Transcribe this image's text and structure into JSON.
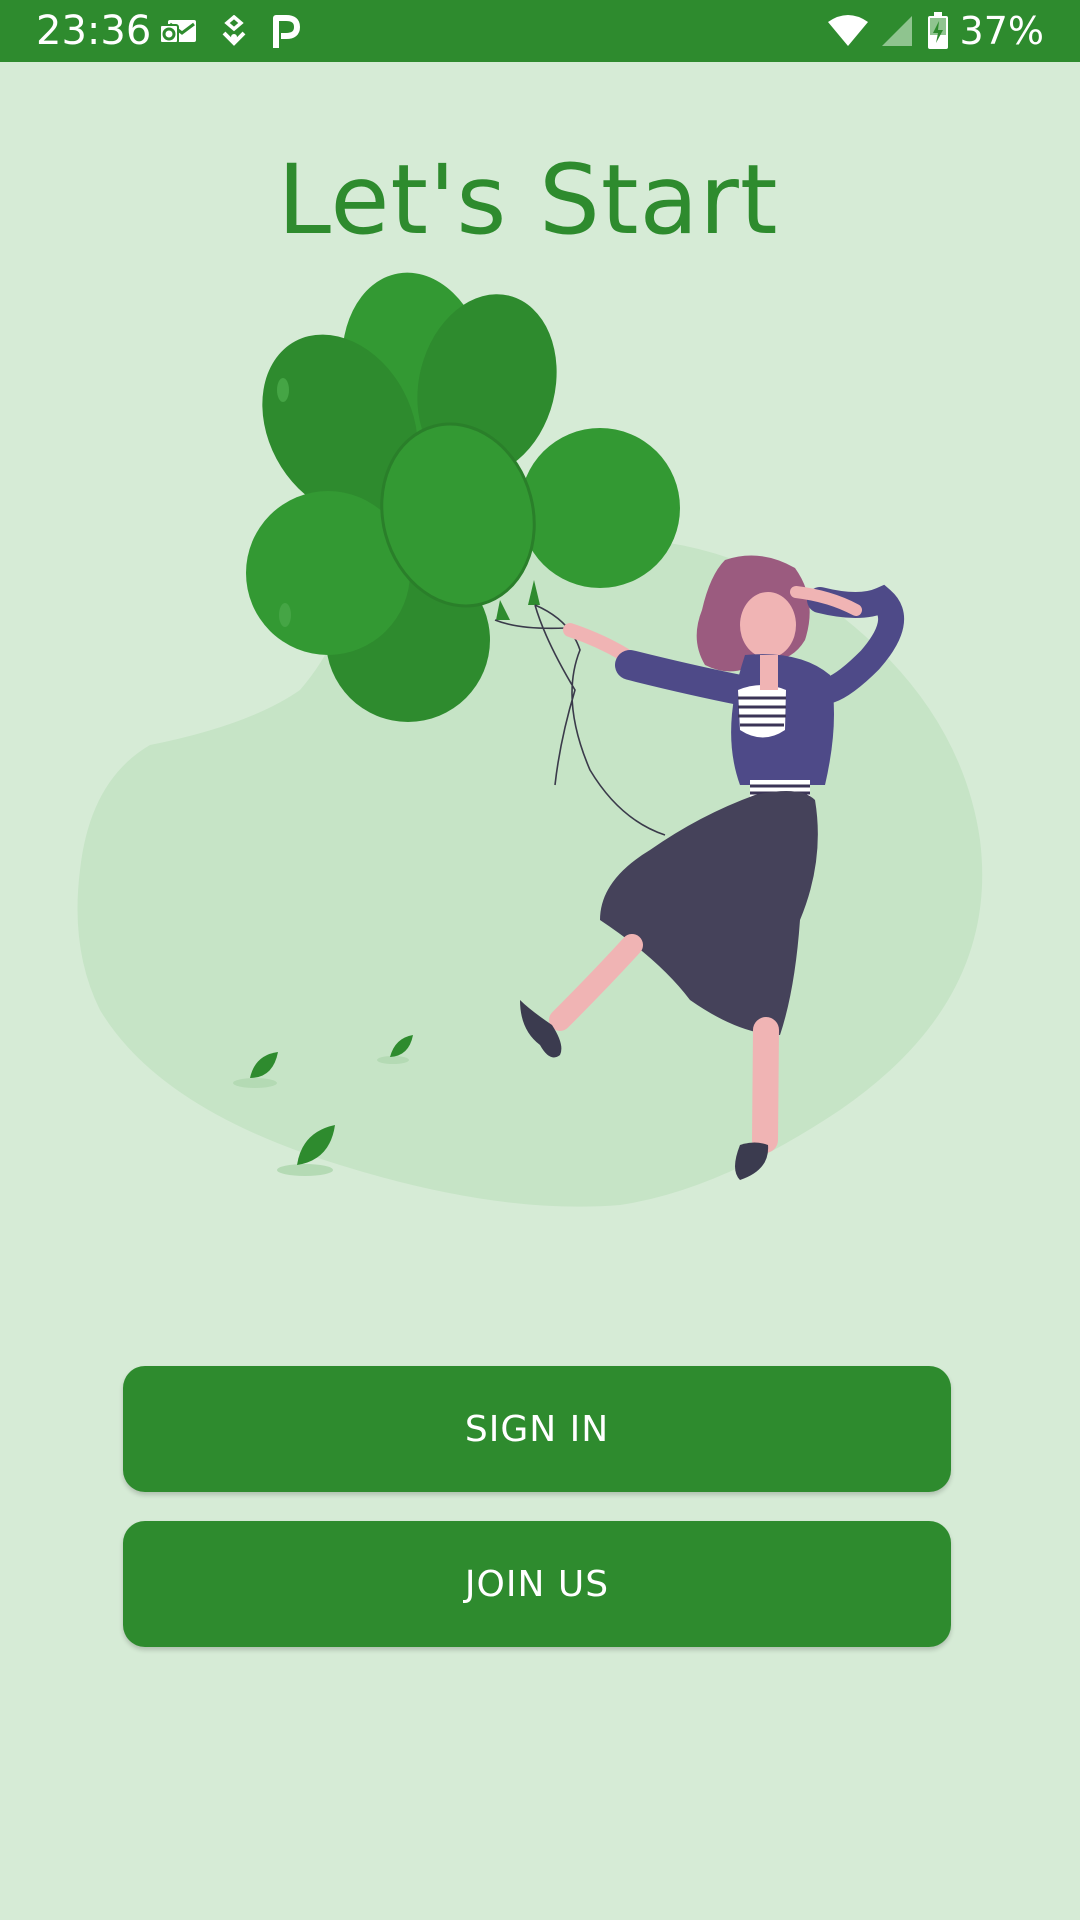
{
  "status_bar": {
    "time": "23:36",
    "battery_percent": "37%",
    "icons": [
      "outlook-icon",
      "location-pin-icon",
      "parking-app-icon",
      "wifi-icon",
      "cell-signal-icon",
      "battery-charging-icon"
    ]
  },
  "title": "Let's Start",
  "buttons": {
    "sign_in": "SIGN IN",
    "join_us": "JOIN US"
  },
  "colors": {
    "primary": "#2e8b2e",
    "background": "#d6ebd6",
    "blob": "#c6e4c6"
  }
}
